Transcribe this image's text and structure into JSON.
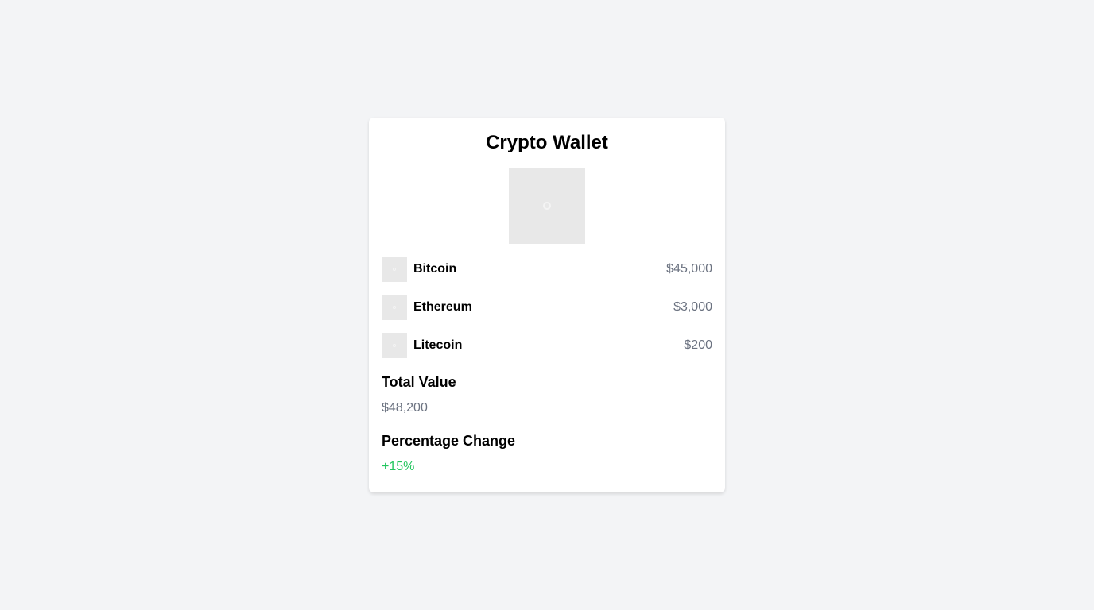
{
  "title": "Crypto Wallet",
  "coins": [
    {
      "name": "Bitcoin",
      "price": "$45,000"
    },
    {
      "name": "Ethereum",
      "price": "$3,000"
    },
    {
      "name": "Litecoin",
      "price": "$200"
    }
  ],
  "total": {
    "label": "Total Value",
    "value": "$48,200"
  },
  "change": {
    "label": "Percentage Change",
    "value": "+15%",
    "color": "#22c55e"
  }
}
